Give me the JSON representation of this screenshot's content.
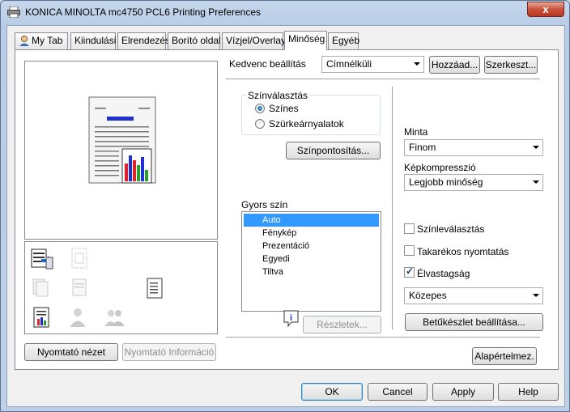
{
  "window": {
    "title": "KONICA MINOLTA mc4750 PCL6 Printing Preferences",
    "close_glyph": "x"
  },
  "tabs": [
    {
      "label": "My Tab"
    },
    {
      "label": "Kiindulási"
    },
    {
      "label": "Elrendezés"
    },
    {
      "label": "Borító oldal"
    },
    {
      "label": "Vízjel/Overlay"
    },
    {
      "label": "Minőség"
    },
    {
      "label": "Egyéb"
    }
  ],
  "favorites": {
    "label": "Kedvenc beállítás",
    "value": "Címnélküli",
    "add_button": "Hozzáad...",
    "edit_button": "Szerkeszt..."
  },
  "color_select": {
    "group_label": "Színválasztás",
    "option_color": "Színes",
    "option_gray": "Szürkeárnyalatok",
    "selected": "Színes",
    "adjust_button": "Színpontosítás..."
  },
  "quick_color": {
    "label": "Gyors szín",
    "items": [
      "Auto",
      "Fénykép",
      "Prezentáció",
      "Egyedi",
      "Tiltva"
    ],
    "selected": "Auto",
    "details_button": "Részletek..."
  },
  "right_panel": {
    "pattern_label": "Minta",
    "pattern_value": "Finom",
    "compression_label": "Képkompresszió",
    "compression_value": "Legjobb minőség",
    "separation_label": "Színleválasztás",
    "separation_checked": false,
    "economy_label": "Takarékos nyomtatás",
    "economy_checked": false,
    "sharpness_label": "Élvastagság",
    "sharpness_checked": true,
    "sharpness_value": "Közepes",
    "font_button": "Betűkészlet beállítása..."
  },
  "left_panel": {
    "printer_view_button": "Nyomtató nézet",
    "printer_info_button": "Nyomtató Információ"
  },
  "defaults_button": "Alapértelmez.",
  "dialog_buttons": {
    "ok": "OK",
    "cancel": "Cancel",
    "apply": "Apply",
    "help": "Help"
  },
  "colors": {
    "chart_blue": "#1f2fd0",
    "chart_red": "#e0202a",
    "chart_green": "#23a323",
    "selection": "#3399ff"
  }
}
